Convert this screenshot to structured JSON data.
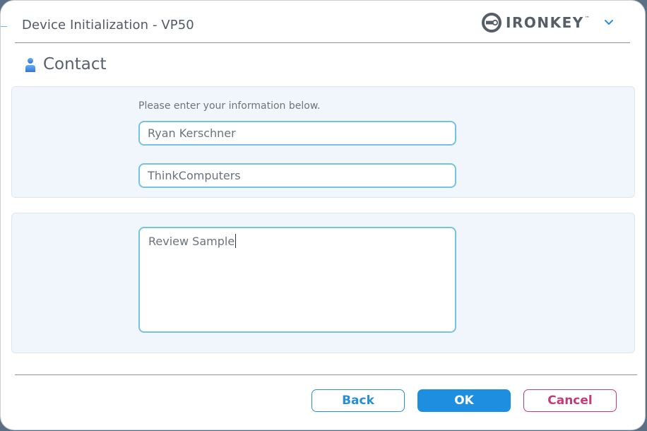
{
  "window": {
    "title": "Device Initialization - VP50"
  },
  "logo": {
    "text": "IRONKEY",
    "trademark": "™",
    "icon": "ironkey-logo-icon"
  },
  "header_menu": {
    "icon": "chevron-down-icon"
  },
  "section": {
    "icon": "person-icon",
    "title": "Contact"
  },
  "form": {
    "instruction": "Please enter your information below.",
    "name_value": "Ryan Kerschner",
    "company_value": "ThinkComputers",
    "notes_value": "Review Sample"
  },
  "buttons": {
    "back": "Back",
    "ok": "OK",
    "cancel": "Cancel"
  },
  "colors": {
    "accent": "#1d8ee0",
    "field_border": "#76c2e0",
    "cancel": "#c23b7a",
    "panel_bg": "#f0f6fb"
  }
}
